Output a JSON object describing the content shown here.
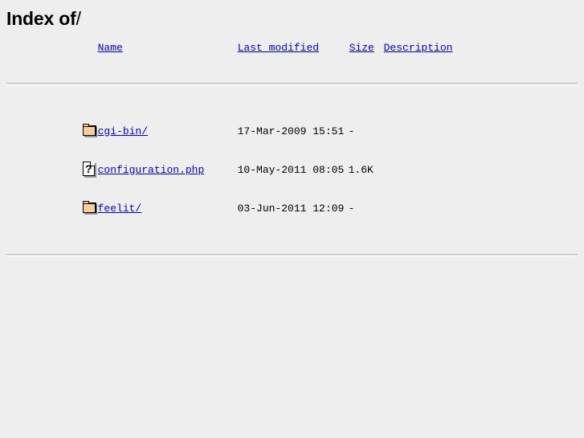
{
  "page": {
    "title_main": "Index of",
    "title_path": "/",
    "background_color": "#eeeeee",
    "link_color": "#0000cc"
  },
  "listing": {
    "columns": [
      {
        "key": "name",
        "label": "Name",
        "icon": "sort-by-name"
      },
      {
        "key": "lastmod",
        "label": "Last modified",
        "icon": "sort-by-date"
      },
      {
        "key": "size",
        "label": "Size",
        "icon": "sort-by-size"
      },
      {
        "key": "description",
        "label": "Description",
        "icon": "sort-by-description"
      }
    ],
    "rows": [
      {
        "icon": "folder-icon",
        "name": "cgi-bin/",
        "last_modified": "17-Mar-2009 15:51",
        "size": "-",
        "description": ""
      },
      {
        "icon": "unknown-file-icon",
        "name": "configuration.php",
        "last_modified": "10-May-2011 08:05",
        "size": "1.6K",
        "description": ""
      },
      {
        "icon": "folder-icon",
        "name": "feelit/",
        "last_modified": "03-Jun-2011 12:09",
        "size": "-",
        "description": ""
      }
    ]
  },
  "icons": {
    "unknown_glyph": "?"
  }
}
